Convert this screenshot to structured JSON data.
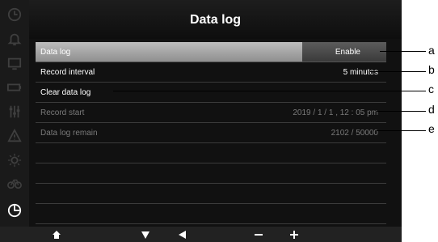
{
  "header": {
    "title": "Data log"
  },
  "rows": [
    {
      "label": "Data log",
      "value": "Enable"
    },
    {
      "label": "Record interval",
      "value": "5 minutes"
    },
    {
      "label": "Clear data log",
      "value": ""
    },
    {
      "label": "Record start",
      "value": "2019 / 1 / 1 , 12 : 05 pm"
    },
    {
      "label": "Data log remain",
      "value": "2102 / 50000"
    }
  ],
  "callouts": [
    "a",
    "b",
    "c",
    "d",
    "e"
  ],
  "sidebar_icons": [
    "clock-icon",
    "bell-icon",
    "screen-icon",
    "battery-icon",
    "sliders-icon",
    "warning-icon",
    "sun-icon",
    "bike-icon",
    "pie-clock-icon"
  ],
  "bottom_nav": [
    "home-icon",
    "down-arrow-icon",
    "left-arrow-icon",
    "minus-icon",
    "plus-icon"
  ],
  "colors": {
    "selected_row": "#a8a8a8",
    "value_box": "#4a4a4a",
    "screen_bg": "#111111"
  }
}
